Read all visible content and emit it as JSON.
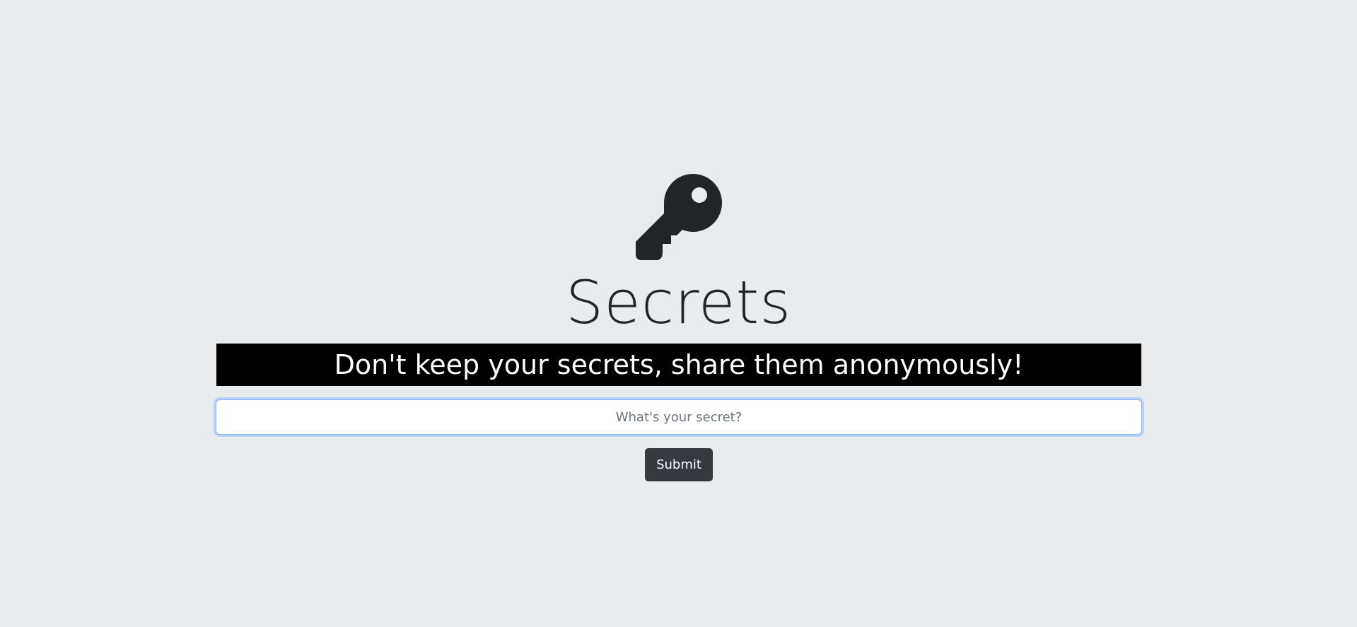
{
  "hero": {
    "icon": "key-icon",
    "title": "Secrets",
    "tagline": "Don't keep your secrets, share them anonymously!"
  },
  "form": {
    "secret_placeholder": "What's your secret?",
    "secret_value": "",
    "submit_label": "Submit"
  },
  "colors": {
    "background": "#e9ecef",
    "text": "#212529",
    "banner_background": "#000000",
    "banner_text": "#ffffff",
    "button_background": "#343a40",
    "input_focus_border": "#86b7fe"
  }
}
